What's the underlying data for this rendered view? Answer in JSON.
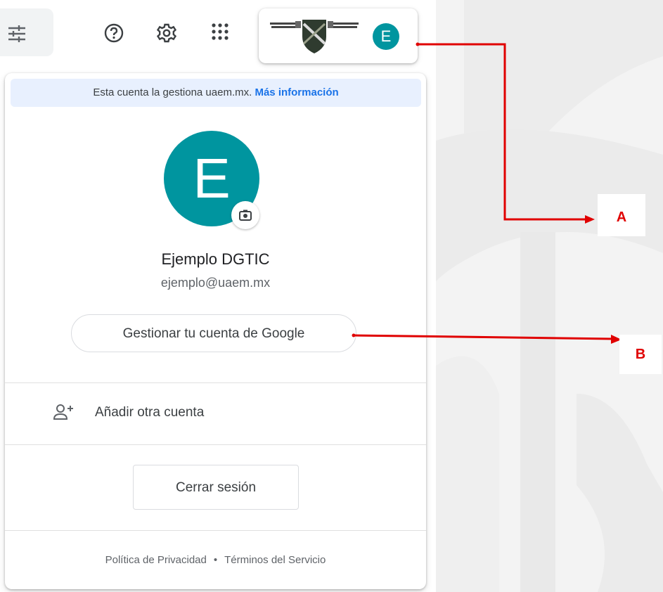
{
  "toolbar": {
    "icons": [
      "tune-icon",
      "help-icon",
      "gear-icon",
      "apps-grid-icon"
    ],
    "avatar_letter": "E"
  },
  "popup": {
    "managed_text": "Esta cuenta la gestiona uaem.mx.",
    "managed_link": "Más información",
    "avatar_letter": "E",
    "name": "Ejemplo DGTIC",
    "email": "ejemplo@uaem.mx",
    "manage_button": "Gestionar tu cuenta de Google",
    "add_account": "Añadir otra cuenta",
    "logout_button": "Cerrar sesión",
    "privacy_link": "Política de Privacidad",
    "separator": "•",
    "terms_link": "Términos del Servicio"
  },
  "annotations": {
    "label_a": "A",
    "label_b": "B",
    "color": "#e00000"
  },
  "colors": {
    "avatar_bg": "#00959f",
    "managed_bg": "#e8f0fe",
    "link": "#1a73e8"
  }
}
